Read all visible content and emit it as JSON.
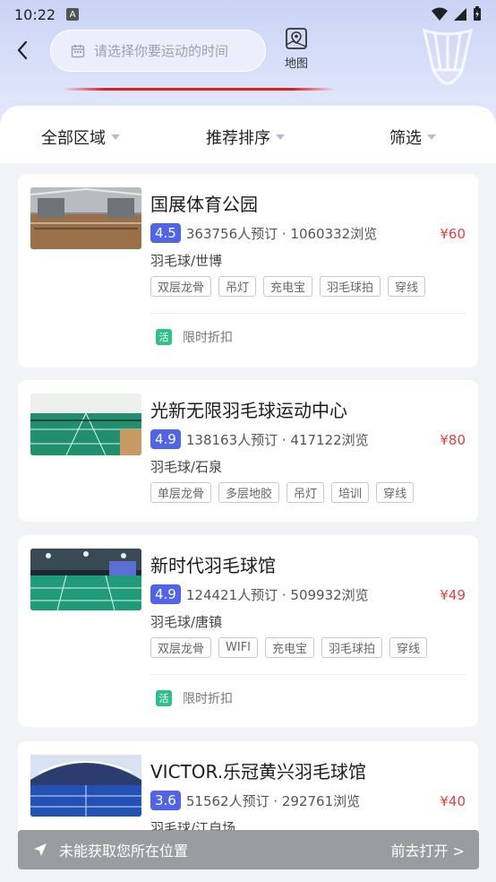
{
  "status_bar": {
    "time": "10:22",
    "a_badge": "A"
  },
  "header": {
    "search_placeholder": "请选择你要运动的时间",
    "map_label": "地图"
  },
  "filters": [
    "全部区域",
    "推荐排序",
    "筛选"
  ],
  "venues": [
    {
      "name": "国展体育公园",
      "score": "4.5",
      "stats": "363756人预订 · 1060332浏览",
      "price": "¥60",
      "category": "羽毛球/世博",
      "tags": [
        "双层龙骨",
        "吊灯",
        "充电宝",
        "羽毛球拍",
        "穿线"
      ],
      "promo_badge": "活",
      "promo_text": "限时折扣",
      "thumb_theme": "gym"
    },
    {
      "name": "光新无限羽毛球运动中心",
      "score": "4.9",
      "stats": "138163人预订 · 417122浏览",
      "price": "¥80",
      "category": "羽毛球/石泉",
      "tags": [
        "单层龙骨",
        "多层地胶",
        "吊灯",
        "培训",
        "穿线"
      ],
      "promo_badge": "",
      "promo_text": "",
      "thumb_theme": "green"
    },
    {
      "name": "新时代羽毛球馆",
      "score": "4.9",
      "stats": "124421人预订 · 509932浏览",
      "price": "¥49",
      "category": "羽毛球/唐镇",
      "tags": [
        "双层龙骨",
        "WIFI",
        "充电宝",
        "羽毛球拍",
        "穿线"
      ],
      "promo_badge": "活",
      "promo_text": "限时折扣",
      "thumb_theme": "dark-green"
    },
    {
      "name": "VICTOR.乐冠黄兴羽毛球馆",
      "score": "3.6",
      "stats": "51562人预订 · 292761浏览",
      "price": "¥40",
      "category": "羽毛球/江自场",
      "tags": [],
      "promo_badge": "",
      "promo_text": "",
      "thumb_theme": "blue"
    }
  ],
  "location_bar": {
    "text": "未能获取您所在位置",
    "action": "前去打开 >"
  },
  "colors": {
    "score_badge": "#4f64e8",
    "price": "#e64040",
    "promo_badge": "#2fc08a"
  }
}
